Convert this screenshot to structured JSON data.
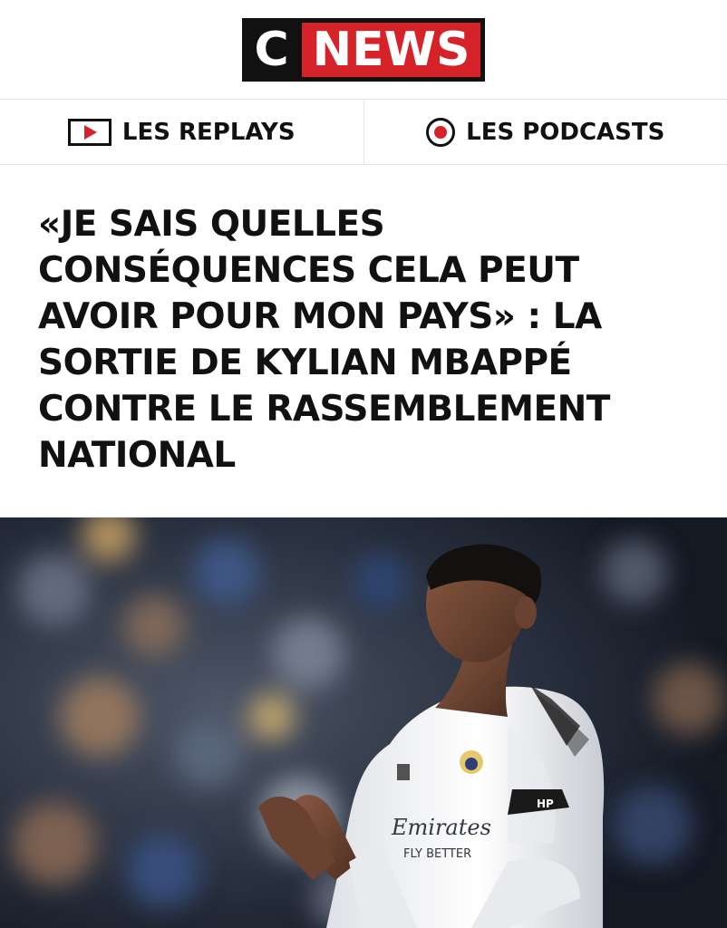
{
  "brand": {
    "logo_c": "C",
    "logo_news": "NEWS"
  },
  "nav": {
    "replays_label": "LES REPLAYS",
    "podcasts_label": "LES PODCASTS"
  },
  "article": {
    "headline": "«JE SAIS QUELLES CONSÉQUENCES CELA PEUT AVOIR POUR MON PAYS» : LA SORTIE DE KYLIAN MBAPPÉ CONTRE LE RASSEMBLEMENT NATIONAL",
    "photo_sponsor": "Emirates",
    "photo_sponsor_line2": "FLY BETTER"
  },
  "colors": {
    "accent": "#d6232a",
    "dark": "#111111"
  }
}
